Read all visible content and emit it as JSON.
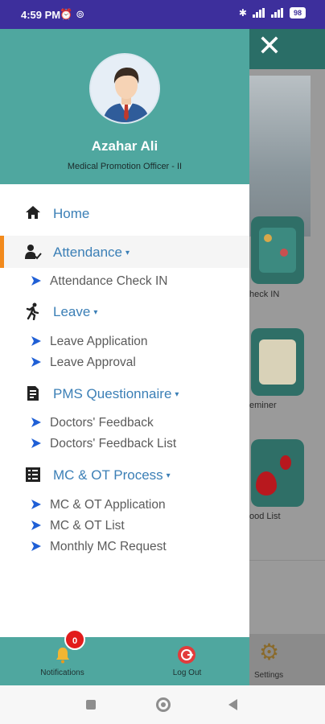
{
  "status_bar": {
    "time": "4:59 PM",
    "icons": [
      "alarm-icon",
      "hotspot-icon"
    ],
    "battery": "98"
  },
  "background_app": {
    "labels": [
      "heck IN",
      "eminer",
      "ood List"
    ],
    "settings_label": "Settings"
  },
  "drawer": {
    "user_name": "Azahar Ali",
    "user_role": "Medical Promotion Officer - II",
    "menu": {
      "home": "Home",
      "attendance": "Attendance",
      "attendance_check_in": "Attendance Check IN",
      "leave": "Leave",
      "leave_application": "Leave Application",
      "leave_approval": "Leave Approval",
      "pms": "PMS Questionnaire",
      "doctors_feedback": "Doctors' Feedback",
      "doctors_feedback_list": "Doctors' Feedback List",
      "mc_ot": "MC & OT Process",
      "mc_ot_application": "MC & OT Application",
      "mc_ot_list": "MC & OT List",
      "monthly_mc_request": "Monthly MC Request",
      "caret": "▾"
    },
    "footer": {
      "notifications_label": "Notifications",
      "notifications_count": "0",
      "logout_label": "Log Out"
    }
  },
  "colors": {
    "status_bar": "#3d2f9c",
    "drawer_header": "#4fa79f",
    "menu_text": "#3b7fb6",
    "active_indicator": "#f28a1c",
    "submenu_arrow": "#1f5fd6",
    "badge": "#e21b1b"
  }
}
